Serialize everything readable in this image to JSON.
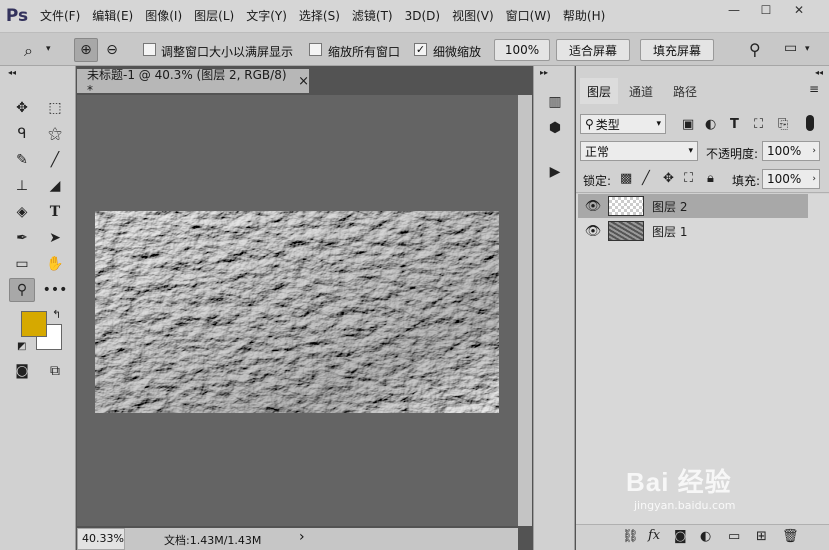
{
  "app": {
    "logo": "Ps"
  },
  "menu": [
    "文件(F)",
    "编辑(E)",
    "图像(I)",
    "图层(L)",
    "文字(Y)",
    "选择(S)",
    "滤镜(T)",
    "3D(D)",
    "视图(V)",
    "窗口(W)",
    "帮助(H)"
  ],
  "window_controls": {
    "minimize": "—",
    "maximize": "☐",
    "close": "✕"
  },
  "options": {
    "resize_windows_label": "调整窗口大小以满屏显示",
    "zoom_all_label": "缩放所有窗口",
    "scrubby_zoom_label": "细微缩放",
    "scrubby_checked": true,
    "zoom_value": "100%",
    "fit_screen_label": "适合屏幕",
    "fill_screen_label": "填充屏幕"
  },
  "document": {
    "tab_title": "未标题-1 @ 40.3% (图层 2, RGB/8) *",
    "tab_close": "×",
    "zoom_status": "40.33%",
    "doc_info": "文档:1.43M/1.43M",
    "status_arrow": "›"
  },
  "layers_panel": {
    "tabs": [
      "图层",
      "通道",
      "路径"
    ],
    "active_tab": "图层",
    "filter_kind": "类型",
    "blend_mode": "正常",
    "opacity_label": "不透明度:",
    "opacity_value": "100%",
    "lock_label": "锁定:",
    "fill_label": "填充:",
    "fill_value": "100%",
    "layers": [
      {
        "name": "图层 2",
        "visible": true,
        "selected": true
      },
      {
        "name": "图层 1",
        "visible": true,
        "selected": false
      }
    ]
  },
  "colors": {
    "foreground": "#d6a900",
    "background": "#ffffff",
    "canvas_bg": "#646464",
    "selected_layer": "#a8a8a8"
  },
  "icons": [
    "zoom-tool-icon",
    "move-tool-icon",
    "marquee-icon",
    "lasso-icon",
    "magic-wand-icon",
    "eyedropper-icon",
    "brush-icon",
    "stamp-icon",
    "eraser-icon",
    "bucket-icon",
    "type-icon",
    "pen-icon",
    "path-select-icon",
    "rectangle-icon",
    "hand-icon",
    "zoom-icon",
    "more-icon",
    "search-icon",
    "workspace-icon",
    "eye-icon",
    "link-icon",
    "fx-icon",
    "mask-icon",
    "adjustment-icon",
    "group-icon",
    "new-layer-icon",
    "trash-icon"
  ],
  "watermark": {
    "brand": "Bai 经验",
    "url": "jingyan.baidu.com"
  }
}
